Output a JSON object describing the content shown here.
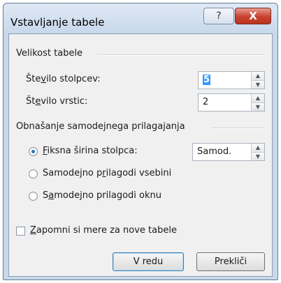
{
  "window": {
    "title": "Vstavljanje tabele",
    "help_glyph": "?",
    "close_glyph": "X"
  },
  "size_section": {
    "label": "Velikost tabele",
    "columns": {
      "label_pre": "Šte",
      "label_u": "v",
      "label_post": "ilo stolpcev:",
      "value": "5"
    },
    "rows": {
      "label_pre": "Št",
      "label_u": "e",
      "label_post": "vilo vrstic:",
      "value": "2"
    }
  },
  "autofit_section": {
    "label": "Obnašanje samodejnega prilagajanja",
    "fixed": {
      "label_u": "F",
      "label_post": "iksna širina stolpca:",
      "value": "Samod.",
      "selected": true
    },
    "contents": {
      "label_pre": "Samodejno p",
      "label_u": "r",
      "label_post": "ilagodi vsebini",
      "selected": false
    },
    "window": {
      "label_pre": "S",
      "label_u": "a",
      "label_post": "modejno prilagodi oknu",
      "selected": false
    }
  },
  "remember": {
    "label_u": "Z",
    "label_post": "apomni si mere za nove tabele",
    "checked": false
  },
  "buttons": {
    "ok": "V redu",
    "cancel": "Prekliči"
  }
}
